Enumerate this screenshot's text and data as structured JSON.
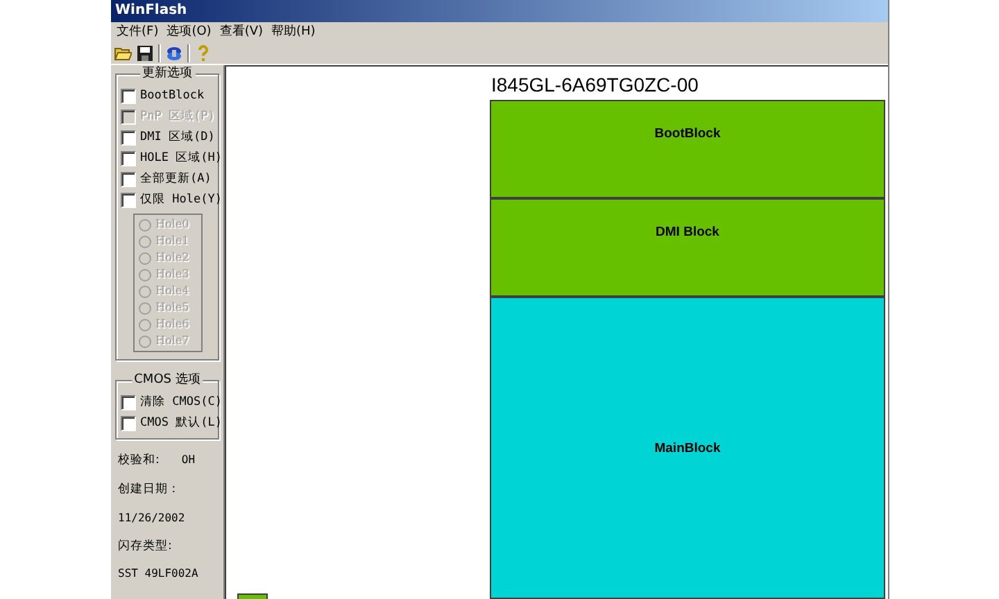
{
  "window": {
    "title": "WinFlash"
  },
  "menu": [
    "文件(F)",
    "选项(O)",
    "查看(V)",
    "帮助(H)"
  ],
  "update_options": {
    "title": "更新选项",
    "checkboxes": [
      {
        "label": "BootBlock",
        "checked": false,
        "disabled": false
      },
      {
        "label": "PnP 区域(P)",
        "checked": false,
        "disabled": true
      },
      {
        "label": "DMI 区域(D)",
        "checked": false,
        "disabled": false
      },
      {
        "label": "HOLE 区域(H)",
        "checked": false,
        "disabled": false
      },
      {
        "label": "全部更新(A)",
        "checked": false,
        "disabled": false
      },
      {
        "label": "仅限 Hole(Y)",
        "checked": false,
        "disabled": false
      }
    ],
    "holes": [
      {
        "label": "Hole0",
        "selected": false,
        "disabled": true
      },
      {
        "label": "Hole1",
        "selected": false,
        "disabled": true
      },
      {
        "label": "Hole2",
        "selected": false,
        "disabled": true
      },
      {
        "label": "Hole3",
        "selected": false,
        "disabled": true
      },
      {
        "label": "Hole4",
        "selected": false,
        "disabled": true
      },
      {
        "label": "Hole5",
        "selected": false,
        "disabled": true
      },
      {
        "label": "Hole6",
        "selected": false,
        "disabled": true
      },
      {
        "label": "Hole7",
        "selected": false,
        "disabled": true
      }
    ]
  },
  "cmos_options": {
    "title": "CMOS 选项",
    "checkboxes": [
      {
        "label": "清除 CMOS(C)",
        "checked": false,
        "disabled": false
      },
      {
        "label": "CMOS 默认(L)",
        "checked": false,
        "disabled": false
      }
    ]
  },
  "info": [
    {
      "kind": "inline",
      "label": "校验和:",
      "value": "OH"
    },
    {
      "kind": "stacked",
      "label": "创建日期 :",
      "value": "11/26/2002"
    },
    {
      "kind": "stacked",
      "label": "闪存类型:",
      "value": "SST 49LF002A"
    }
  ],
  "chip_map": {
    "title": "I845GL-6A69TG0ZC-00",
    "blocks": [
      {
        "label": "BootBlock",
        "color": "#66c000"
      },
      {
        "label": "DMI Block",
        "color": "#66c000"
      },
      {
        "label": "MainBlock",
        "color": "#00d4d4"
      }
    ],
    "legend": [
      {
        "color": "#66c000"
      }
    ]
  }
}
